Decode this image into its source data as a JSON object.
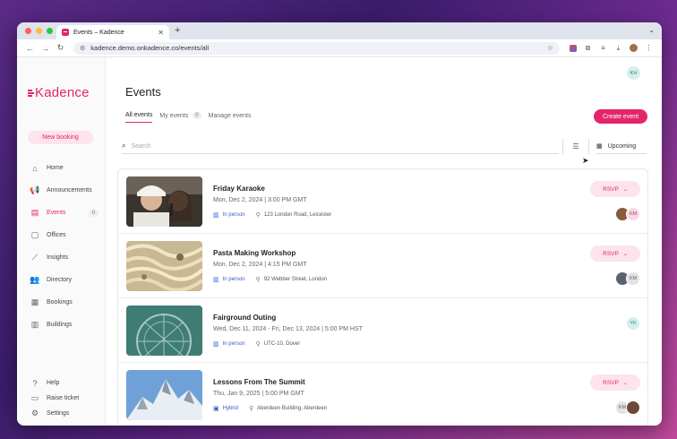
{
  "browser": {
    "tab_title": "Events – Kadence",
    "url": "kadence.demo.onkadence.co/events/all"
  },
  "app": {
    "logo_text": "Kadence",
    "new_booking": "New booking",
    "user_initials": "KH",
    "accent": "#e3256b"
  },
  "sidebar": {
    "items": [
      {
        "label": "Home",
        "icon": "home-icon"
      },
      {
        "label": "Announcements",
        "icon": "megaphone-icon"
      },
      {
        "label": "Events",
        "icon": "calendar-icon",
        "count": "0",
        "active": true
      },
      {
        "label": "Offices",
        "icon": "office-icon"
      },
      {
        "label": "Insights",
        "icon": "chart-icon"
      },
      {
        "label": "Directory",
        "icon": "people-icon"
      },
      {
        "label": "Bookings",
        "icon": "bookings-icon"
      },
      {
        "label": "Buildings",
        "icon": "building-icon"
      }
    ],
    "bottom": [
      {
        "label": "Help",
        "icon": "help-icon"
      },
      {
        "label": "Raise ticket",
        "icon": "ticket-icon"
      },
      {
        "label": "Settings",
        "icon": "gear-icon"
      }
    ]
  },
  "main": {
    "title": "Events",
    "tabs": [
      {
        "label": "All events"
      },
      {
        "label": "My events",
        "count": "0"
      },
      {
        "label": "Manage events"
      }
    ],
    "create_button": "Create event",
    "search_placeholder": "Search",
    "upcoming_label": "Upcoming"
  },
  "events": [
    {
      "title": "Friday Karaoke",
      "date": "Mon, Dec 2, 2024  |  3:00 PM GMT",
      "type": "In person",
      "location": "123 London Road, Leicester",
      "rsvp": "RSVP",
      "attendees": [
        "",
        "KM"
      ]
    },
    {
      "title": "Pasta Making Workshop",
      "date": "Mon, Dec 2, 2024  |  4:15 PM GMT",
      "type": "In person",
      "location": "92 Webber Street, London",
      "rsvp": "RSVP",
      "attendees": [
        "",
        "KM"
      ]
    },
    {
      "title": "Fairground Outing",
      "date": "Wed, Dec 11, 2024 - Fri, Dec 13, 2024  |  5:00 PM HST",
      "type": "In person",
      "location": "UTC-10, Dover",
      "rsvp": "",
      "attendees": [
        "YK"
      ]
    },
    {
      "title": "Lessons From The Summit",
      "date": "Thu, Jan 9, 2025  |  5:00 PM GMT",
      "type": "Hybrid",
      "location": "Aberdeen Building, Aberdeen",
      "rsvp": "RSVP",
      "attendees": [
        "KM",
        ""
      ]
    }
  ]
}
